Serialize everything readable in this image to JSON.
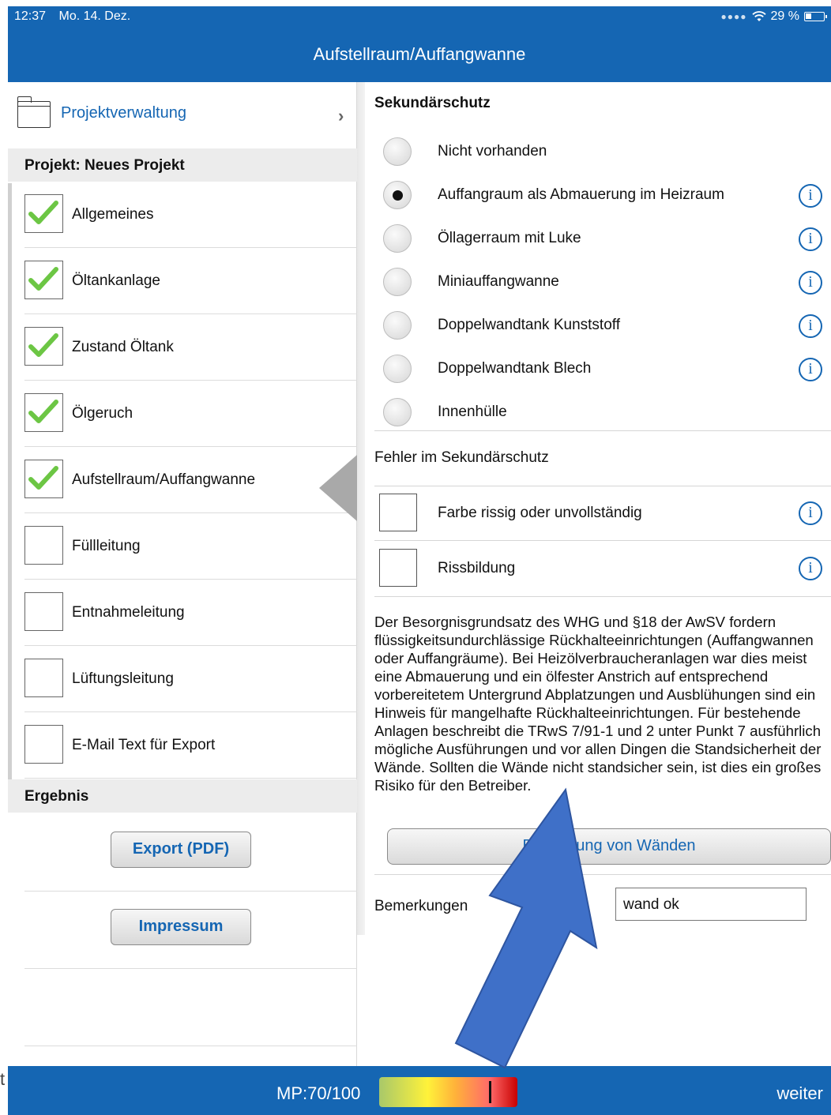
{
  "status_bar": {
    "time": "12:37",
    "date": "Mo. 14. Dez.",
    "battery": "29 %"
  },
  "nav_title": "Aufstellraum/Auffangwanne",
  "sidebar": {
    "project_management": "Projektverwaltung",
    "project_header": "Projekt: Neues Projekt",
    "items": [
      {
        "label": "Allgemeines",
        "checked": true
      },
      {
        "label": "Öltankanlage",
        "checked": true
      },
      {
        "label": "Zustand Öltank",
        "checked": true
      },
      {
        "label": "Ölgeruch",
        "checked": true
      },
      {
        "label": "Aufstellraum/Auffangwanne",
        "checked": true,
        "active": true
      },
      {
        "label": "Füllleitung",
        "checked": false
      },
      {
        "label": "Entnahmeleitung",
        "checked": false
      },
      {
        "label": "Lüftungsleitung",
        "checked": false
      },
      {
        "label": "E-Mail Text für Export",
        "checked": false
      }
    ],
    "result_header": "Ergebnis",
    "export_button": "Export (PDF)",
    "imprint_button": "Impressum"
  },
  "main": {
    "section_title": "Sekundärschutz",
    "options": [
      {
        "label": "Nicht vorhanden",
        "selected": false,
        "info": false
      },
      {
        "label": "Auffangraum als Abmauerung im Heizraum",
        "selected": true,
        "info": true
      },
      {
        "label": "Öllagerraum mit Luke",
        "selected": false,
        "info": true
      },
      {
        "label": "Miniauffangwanne",
        "selected": false,
        "info": true
      },
      {
        "label": "Doppelwandtank Kunststoff",
        "selected": false,
        "info": true
      },
      {
        "label": "Doppelwandtank Blech",
        "selected": false,
        "info": true
      },
      {
        "label": "Innenhülle",
        "selected": false,
        "info": false
      }
    ],
    "errors_title": "Fehler im Sekundärschutz",
    "errors": [
      {
        "label": "Farbe rissig oder unvollständig",
        "checked": false
      },
      {
        "label": "Rissbildung",
        "checked": false
      }
    ],
    "info_symbol": "i",
    "description": "Der Besorgnisgrundsatz des WHG und §18 der AwSV fordern flüssigkeitsundurchlässige Rückhalteeinrichtungen (Auffangwannen oder Auffangräume). Bei Heizölverbraucheranlagen war dies meist eine Abmauerung und ein ölfester Anstrich auf entsprechend vorbereitetem Untergrund Abplatzungen und Ausblühungen sind ein Hinweis für mangelhafte Rückhalteeinrichtungen. Für bestehende Anlagen beschreibt die TRwS 7/91-1 und 2 unter Punkt 7 ausführlich mögliche Ausführungen und vor allen Dingen die Standsicherheit der Wände. Sollten die Wände nicht standsicher sein, ist dies ein großes Risiko für den Betreiber.",
    "assess_button": "Beurteilung von Wänden",
    "remarks_label": "Bemerkungen",
    "remarks_value": "wand ok"
  },
  "bottom_bar": {
    "mp_label": "MP:70/100",
    "mp_value": 70,
    "mp_max": 100,
    "next_label": "weiter"
  },
  "edge_text": "t",
  "colors": {
    "brand": "#1566b3",
    "checkmark": "#6cc644",
    "annotation_arrow": "#3f70c8"
  }
}
